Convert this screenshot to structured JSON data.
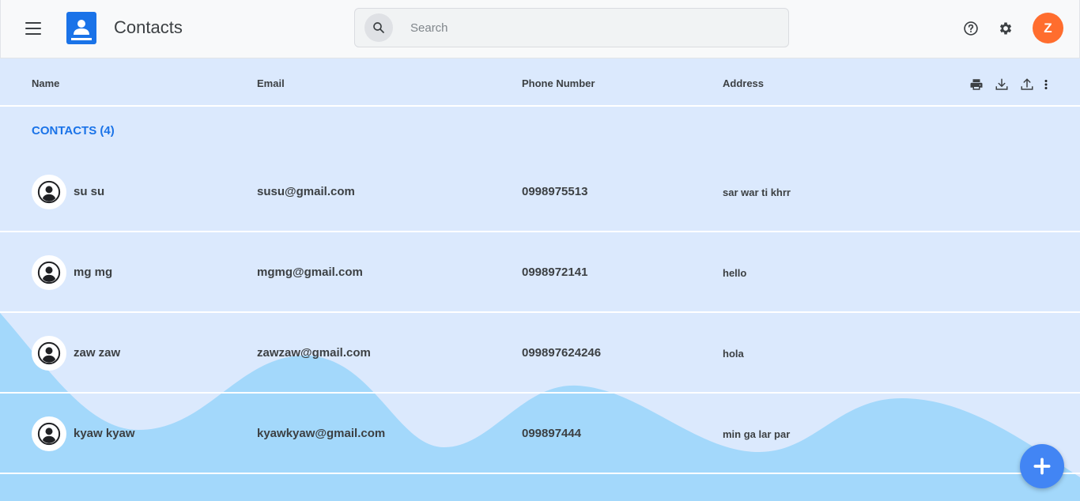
{
  "header": {
    "title": "Contacts",
    "search_placeholder": "Search",
    "avatar_letter": "Z"
  },
  "columns": {
    "name": "Name",
    "email": "Email",
    "phone": "Phone Number",
    "address": "Address"
  },
  "section_label": "CONTACTS (4)",
  "contacts": [
    {
      "name": "su su",
      "email": "susu@gmail.com",
      "phone": "0998975513",
      "address": "sar war ti khrr"
    },
    {
      "name": "mg mg",
      "email": "mgmg@gmail.com",
      "phone": "0998972141",
      "address": "hello"
    },
    {
      "name": "zaw zaw",
      "email": "zawzaw@gmail.com",
      "phone": "099897624246",
      "address": "hola"
    },
    {
      "name": "kyaw kyaw",
      "email": "kyawkyaw@gmail.com",
      "phone": "099897444",
      "address": "min ga lar par"
    }
  ],
  "icons": {
    "menu": "menu-icon",
    "logo": "contacts-logo-icon",
    "search": "search-icon",
    "help": "help-icon",
    "settings": "gear-icon",
    "print": "print-icon",
    "download": "download-icon",
    "upload": "upload-icon",
    "more": "more-vert-icon",
    "contact_avatar": "person-icon",
    "fab": "plus-icon"
  },
  "colors": {
    "accent": "#1a73e8",
    "fab": "#4285f4",
    "avatar": "#ff6d2e",
    "background": "#dbe9fd",
    "wave": "#a3d8fb"
  }
}
